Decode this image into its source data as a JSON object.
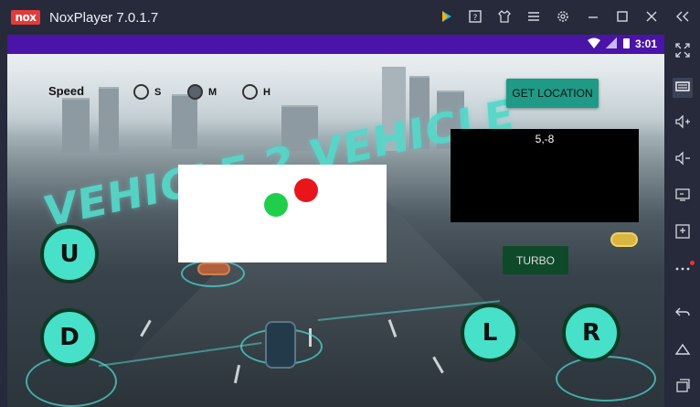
{
  "window": {
    "logo_text": "nox",
    "title": "NoxPlayer 7.0.1.7",
    "toolbar_icons": [
      "play-store-icon",
      "help-icon",
      "theme-icon",
      "menu-icon",
      "settings-icon",
      "minimize-icon",
      "maximize-icon",
      "close-icon",
      "collapse-sidebar-icon"
    ]
  },
  "statusbar": {
    "time": "3:01",
    "wifi_icon": "wifi-icon",
    "battery_icon": "battery-icon"
  },
  "app": {
    "speed_label": "Speed",
    "speed_options": [
      {
        "label": "S",
        "checked": false
      },
      {
        "label": "M",
        "checked": true
      },
      {
        "label": "H",
        "checked": false
      }
    ],
    "get_location_label": "GET LOCATION",
    "location_value": "5,-8",
    "turbo_label": "TURBO",
    "controls": {
      "up": "U",
      "down": "D",
      "left": "L",
      "right": "R"
    },
    "map": {
      "green_dot_color": "#1fcf4a",
      "red_dot_color": "#e8151b"
    },
    "background_banner_text": "VEHICLE 2 VEHICLE"
  },
  "sidebar": {
    "icons": [
      "fullscreen-icon",
      "keyboard-icon",
      "volume-up-icon",
      "volume-down-icon",
      "screen-icon",
      "apk-install-icon",
      "more-icon",
      "back-icon",
      "home-icon",
      "recent-apps-icon"
    ]
  },
  "colors": {
    "accent_purple": "#4b14a8",
    "button_teal": "#1e9a86",
    "control_teal": "#47e0c8",
    "turbo_green": "#0e4a2a"
  }
}
